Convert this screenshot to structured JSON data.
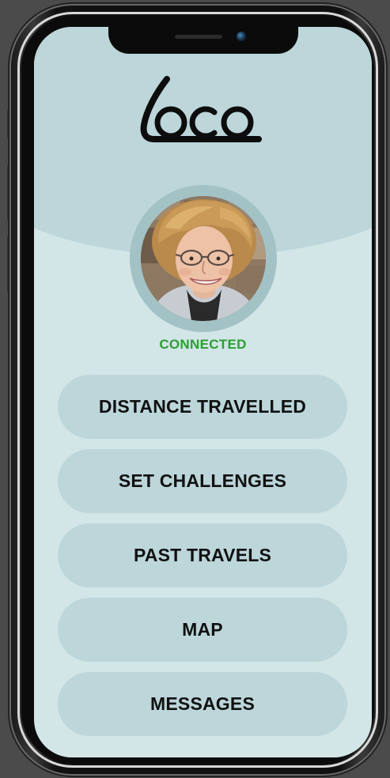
{
  "app": {
    "logo_text": "loco"
  },
  "profile": {
    "status": "CONNECTED",
    "status_color": "#2aa02f"
  },
  "menu": {
    "items": [
      {
        "label": "DISTANCE TRAVELLED"
      },
      {
        "label": "SET CHALLENGES"
      },
      {
        "label": "PAST TRAVELS"
      },
      {
        "label": "MAP"
      },
      {
        "label": "MESSAGES"
      }
    ]
  },
  "theme": {
    "screen_bg": "#d2e5e7",
    "header_bg": "#bcd6da",
    "button_bg": "#bcd6da",
    "avatar_ring": "#a3c2c5"
  }
}
